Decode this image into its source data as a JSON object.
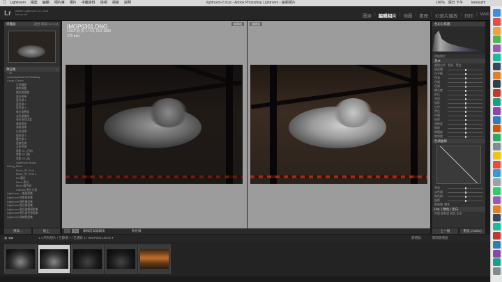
{
  "menubar": {
    "items": [
      "Lightroom",
      "檔案",
      "編輯",
      "相片庫",
      "相片",
      "中繼資料",
      "檢視",
      "視窗",
      "說明"
    ],
    "title": "lightroom-2.lrcat - Adobe Photoshop Lightroom - 編輯相片",
    "right_items": [
      "100%",
      "週日 下午4:43",
      "kennyzhi"
    ]
  },
  "lr": {
    "logo": "Lr",
    "line1": "Adobe Lightroom CC 2015",
    "line2": "kenny zhi",
    "modules": [
      "圖庫",
      "編輯相片",
      "地圖",
      "書冊",
      "幻燈片播放",
      "列印",
      "Web"
    ],
    "active_module": "編輯相片"
  },
  "left": {
    "navigator_label": "導覽器",
    "navigator_zoom": [
      "適合",
      "填滿",
      "1:1",
      "1:3"
    ],
    "presets_label": "預設集",
    "presets": [
      {
        "label": "+ 2b",
        "level": 1
      },
      {
        "label": "LoekmanHertel-00-Wedding",
        "level": 1
      },
      {
        "label": "Lucas_Charm",
        "level": 1
      },
      {
        "label": "正常輪廓",
        "level": 2
      },
      {
        "label": "柔和調整",
        "level": 2
      },
      {
        "label": "暖色調調整",
        "level": 2
      },
      {
        "label": "黑白效果",
        "level": 2
      },
      {
        "label": "藍色調 1",
        "level": 2
      },
      {
        "label": "藍色調 2",
        "level": 2
      },
      {
        "label": "藍色調 3",
        "level": 2
      },
      {
        "label": "復古懷舊風",
        "level": 2
      },
      {
        "label": "淡色調風格",
        "level": 2
      },
      {
        "label": "強化高對比度",
        "level": 2
      },
      {
        "label": "暗部提亮",
        "level": 2
      },
      {
        "label": "清新效果",
        "level": 2
      },
      {
        "label": "日系效果",
        "level": 2
      },
      {
        "label": "暖色調 1",
        "level": 2
      },
      {
        "label": "暖色調 2",
        "level": 2
      },
      {
        "label": "藍紫色調",
        "level": 2
      },
      {
        "label": "淡彩色調",
        "level": 2
      },
      {
        "label": "電影 01 (正常)",
        "level": 2
      },
      {
        "label": "電影 02 (暗)",
        "level": 2
      },
      {
        "label": "電影 03 (淡)",
        "level": 2
      },
      {
        "label": "Lightroom Studio",
        "level": 2
      },
      {
        "label": "Kenny_Moon",
        "level": 1
      },
      {
        "label": "Moon_IR_Tone",
        "level": 2
      },
      {
        "label": "Moon_IR_Tone 2",
        "level": 2
      },
      {
        "label": "Ink 暖色",
        "level": 2
      },
      {
        "label": "Moon 黑白",
        "level": 2
      },
      {
        "label": "Moon 暖色調",
        "level": 2
      },
      {
        "label": "Ultimate 黑白元素",
        "level": 2
      },
      {
        "label": "Lightroom 一般預設集",
        "level": 1
      },
      {
        "label": "Lightroom 效果預設集",
        "level": 1
      },
      {
        "label": "Lightroom 顏色預設集",
        "level": 1
      },
      {
        "label": "Lightroom 黑白預設集",
        "level": 1
      },
      {
        "label": "Lightroom 黑白濾鏡預設集",
        "level": 1
      },
      {
        "label": "Lightroom 黑白調色預設集",
        "level": 1
      },
      {
        "label": "Lightroom 曲線預設集",
        "level": 1
      }
    ],
    "copy_button": "拷貝...",
    "paste_button": "貼上"
  },
  "center": {
    "filename": "IMGP0301.DNG",
    "exposure": "1/320 秒 於 f / 4.0, ISO 1600",
    "focal": "170 mm",
    "before_tag": "編輯前",
    "after_tag": "編輯後",
    "toolbar_mode": "YY",
    "toolbar_label": "編輯前與編輯後",
    "toolbar_proof": "軟校樣"
  },
  "right": {
    "histogram_label": "色彩分佈圖",
    "histogram_info": "原始相片",
    "basic_label": "基本",
    "treatment": [
      "處理方式",
      "色彩",
      "黑白"
    ],
    "rows": [
      "描述檔",
      "白平衡",
      "色溫",
      "色調",
      "色調",
      "曝光度",
      "對比",
      "亮部",
      "陰影",
      "白色",
      "黑色",
      "外觀",
      "紋理",
      "清晰度",
      "細節",
      "鮮豔度",
      "飽和度"
    ],
    "tone_curve_label": "色調曲線",
    "region_rows": [
      "亮部",
      "淡色調",
      "暗色調",
      "陰影"
    ],
    "point_curve": "點曲線: 線性",
    "hsl_label": "HSL / 顏色 / 黑白",
    "hsl_tabs": [
      "色相",
      "飽和度",
      "明度",
      "全部"
    ],
    "prev_button": "上一個",
    "reset_button": "重設 (Adobe)"
  },
  "filmstrip": {
    "path": "1 4 所有相片 / 已篩選 7 / 已選取 1 / IMGP0301.DNG ▾",
    "filter_label": "篩選器:",
    "filter_value": "關閉篩選器"
  }
}
